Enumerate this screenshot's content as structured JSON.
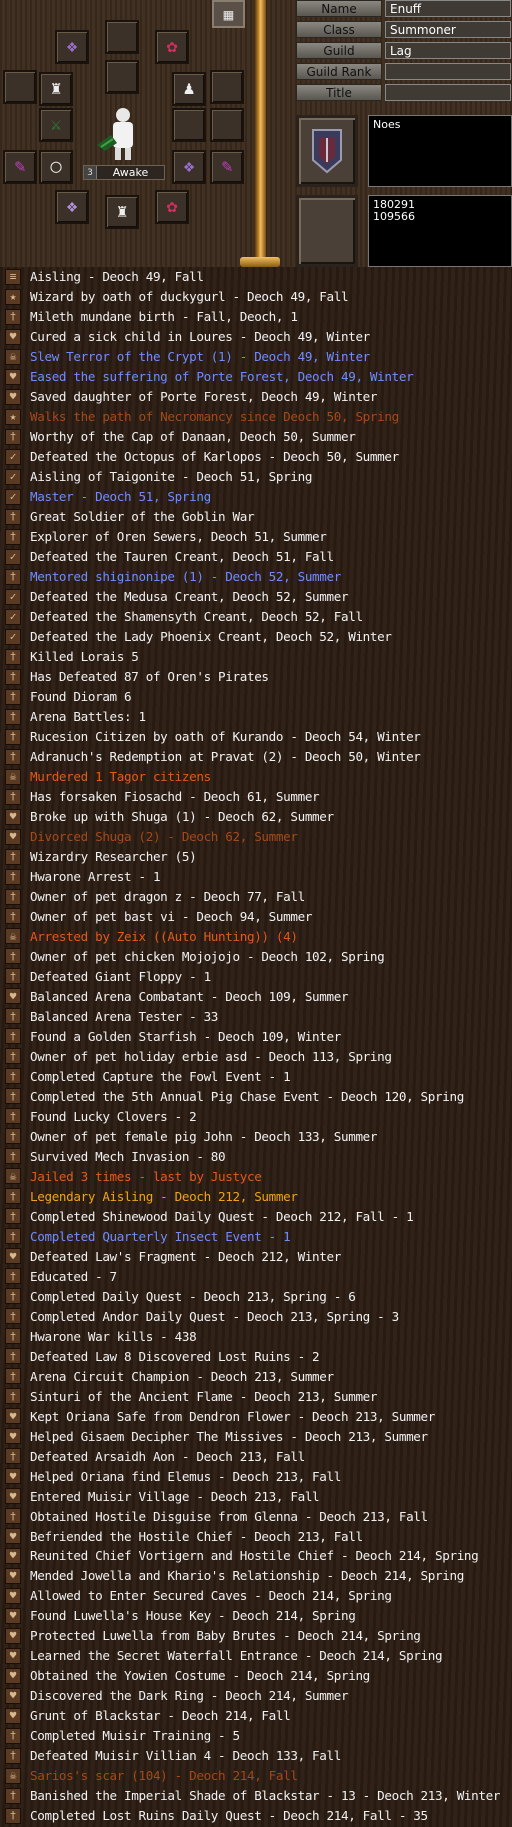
{
  "equipment": {
    "status_number": "3",
    "status_label": "Awake",
    "slot_icons": [
      "necklace-icon",
      "amulet-icon",
      "ring-icon",
      "boot-icon",
      "gauntlet-icon",
      "belt-icon",
      "earring-icon",
      "sword-icon",
      "shield-icon",
      "armor-icon",
      "helm-icon"
    ]
  },
  "profile": {
    "name_label": "Name",
    "name_value": "Enuff",
    "class_label": "Class",
    "class_value": "Summoner",
    "guild_label": "Guild",
    "guild_value": "Lag",
    "guild_rank_label": "Guild Rank",
    "guild_rank_value": "",
    "title_label": "Title",
    "title_value": "",
    "description": "Noes",
    "stats": "180291\n109566"
  },
  "colors": {
    "white": "#f2f2f2",
    "blue": "#6f8dff",
    "orange": "#e25a1a",
    "dark_orange": "#a34a1a",
    "yellow": "#f0a21a"
  },
  "legends": [
    {
      "icon": "scroll-icon",
      "color": "white",
      "text": "Aisling - Deoch 49, Fall"
    },
    {
      "icon": "wizard-icon",
      "color": "white",
      "text": "Wizard by oath of duckygurl - Deoch 49, Fall"
    },
    {
      "icon": "person-icon",
      "color": "white",
      "text": "Mileth mundane birth - Fall, Deoch, 1"
    },
    {
      "icon": "heart-icon",
      "color": "white",
      "text": "Cured a sick child in Loures - Deoch 49, Winter"
    },
    {
      "icon": "skull-icon",
      "color": "blue",
      "text": "Slew Terror of the Crypt (1) - Deoch 49, Winter"
    },
    {
      "icon": "heart-icon",
      "color": "blue",
      "text": "Eased the suffering of Porte Forest, Deoch 49, Winter"
    },
    {
      "icon": "heart-icon",
      "color": "white",
      "text": "Saved daughter of Porte Forest, Deoch 49, Winter"
    },
    {
      "icon": "wizard-icon",
      "color": "dark_orange",
      "text": "Walks the path of Necromancy since Deoch 50, Spring"
    },
    {
      "icon": "person-icon",
      "color": "white",
      "text": "Worthy of the Cap of Danaan, Deoch 50, Summer"
    },
    {
      "icon": "check-icon",
      "color": "white",
      "text": "Defeated the Octopus of Karlopos - Deoch 50, Summer"
    },
    {
      "icon": "check-icon",
      "color": "white",
      "text": "Aisling of Taigonite - Deoch 51, Spring"
    },
    {
      "icon": "check-icon",
      "color": "blue",
      "text": "Master - Deoch 51, Spring"
    },
    {
      "icon": "person-icon",
      "color": "white",
      "text": "Great Soldier of the Goblin War"
    },
    {
      "icon": "person-icon",
      "color": "white",
      "text": "Explorer of Oren Sewers, Deoch 51, Summer"
    },
    {
      "icon": "check-icon",
      "color": "white",
      "text": "Defeated the Tauren Creant, Deoch 51, Fall"
    },
    {
      "icon": "person-icon",
      "color": "blue",
      "text": "Mentored shiginonipe (1) - Deoch 52, Summer"
    },
    {
      "icon": "check-icon",
      "color": "white",
      "text": "Defeated the Medusa Creant, Deoch 52, Summer"
    },
    {
      "icon": "check-icon",
      "color": "white",
      "text": "Defeated the Shamensyth Creant, Deoch 52, Fall"
    },
    {
      "icon": "check-icon",
      "color": "white",
      "text": "Defeated the Lady Phoenix Creant, Deoch 52, Winter"
    },
    {
      "icon": "person-icon",
      "color": "white",
      "text": "Killed Lorais 5"
    },
    {
      "icon": "person-icon",
      "color": "white",
      "text": "Has Defeated 87 of Oren's Pirates"
    },
    {
      "icon": "person-icon",
      "color": "white",
      "text": "Found Dioram 6"
    },
    {
      "icon": "person-icon",
      "color": "white",
      "text": "Arena Battles: 1"
    },
    {
      "icon": "person-icon",
      "color": "white",
      "text": "Rucesion Citizen by oath of Kurando - Deoch 54, Winter"
    },
    {
      "icon": "person-icon",
      "color": "white",
      "text": "Adranuch's Redemption at Pravat (2) - Deoch 50, Winter"
    },
    {
      "icon": "skull-icon",
      "color": "orange",
      "text": "Murdered 1 Tagor citizens"
    },
    {
      "icon": "person-icon",
      "color": "white",
      "text": "Has forsaken Fiosachd - Deoch 61, Summer"
    },
    {
      "icon": "heart-icon",
      "color": "white",
      "text": "Broke up with Shuga (1) - Deoch 62, Summer"
    },
    {
      "icon": "heart-icon",
      "color": "dark_orange",
      "text": "Divorced Shuga (2) - Deoch 62, Summer"
    },
    {
      "icon": "person-icon",
      "color": "white",
      "text": "Wizardry Researcher (5)"
    },
    {
      "icon": "person-icon",
      "color": "white",
      "text": "Hwarone Arrest - 1"
    },
    {
      "icon": "person-icon",
      "color": "white",
      "text": "Owner of pet dragon z - Deoch 77, Fall"
    },
    {
      "icon": "person-icon",
      "color": "white",
      "text": "Owner of pet bast vi - Deoch 94, Summer"
    },
    {
      "icon": "skull-icon",
      "color": "orange",
      "text": "Arrested by Zeix ((Auto Hunting)) (4)"
    },
    {
      "icon": "person-icon",
      "color": "white",
      "text": "Owner of pet chicken Mojojojo - Deoch 102, Spring"
    },
    {
      "icon": "person-icon",
      "color": "white",
      "text": "Defeated Giant Floppy - 1"
    },
    {
      "icon": "heart-icon",
      "color": "white",
      "text": "Balanced Arena Combatant - Deoch 109, Summer"
    },
    {
      "icon": "person-icon",
      "color": "white",
      "text": "Balanced Arena Tester - 33"
    },
    {
      "icon": "person-icon",
      "color": "white",
      "text": "Found a Golden Starfish - Deoch 109, Winter"
    },
    {
      "icon": "person-icon",
      "color": "white",
      "text": "Owner of pet holiday erbie asd - Deoch 113, Spring"
    },
    {
      "icon": "person-icon",
      "color": "white",
      "text": "Completed Capture the Fowl Event - 1"
    },
    {
      "icon": "person-icon",
      "color": "white",
      "text": "Completed the 5th Annual Pig Chase Event - Deoch 120, Spring"
    },
    {
      "icon": "person-icon",
      "color": "white",
      "text": "Found Lucky Clovers - 2"
    },
    {
      "icon": "person-icon",
      "color": "white",
      "text": "Owner of pet female pig John - Deoch 133, Summer"
    },
    {
      "icon": "person-icon",
      "color": "white",
      "text": "Survived Mech Invasion - 80"
    },
    {
      "icon": "skull-icon",
      "color": "orange",
      "text": "Jailed 3 times - last by Justyce"
    },
    {
      "icon": "person-icon",
      "color": "yellow",
      "text": "Legendary Aisling - Deoch 212, Summer"
    },
    {
      "icon": "person-icon",
      "color": "white",
      "text": "Completed Shinewood Daily Quest - Deoch 212, Fall - 1"
    },
    {
      "icon": "person-icon",
      "color": "blue",
      "text": "Completed Quarterly Insect Event - 1"
    },
    {
      "icon": "heart-icon",
      "color": "white",
      "text": "Defeated Law's Fragment - Deoch 212, Winter"
    },
    {
      "icon": "person-icon",
      "color": "white",
      "text": "Educated - 7"
    },
    {
      "icon": "person-icon",
      "color": "white",
      "text": "Completed Daily Quest - Deoch 213, Spring - 6"
    },
    {
      "icon": "person-icon",
      "color": "white",
      "text": "Completed Andor Daily Quest - Deoch 213, Spring - 3"
    },
    {
      "icon": "person-icon",
      "color": "white",
      "text": "Hwarone War kills - 438"
    },
    {
      "icon": "person-icon",
      "color": "white",
      "text": "Defeated Law 8 Discovered Lost Ruins - 2"
    },
    {
      "icon": "person-icon",
      "color": "white",
      "text": "Arena Circuit Champion - Deoch 213, Summer"
    },
    {
      "icon": "person-icon",
      "color": "white",
      "text": "Sinturi of the Ancient Flame - Deoch 213, Summer"
    },
    {
      "icon": "heart-icon",
      "color": "white",
      "text": "Kept Oriana Safe from Dendron Flower - Deoch 213, Summer"
    },
    {
      "icon": "heart-icon",
      "color": "white",
      "text": "Helped Gisaem Decipher The Missives - Deoch 213, Summer"
    },
    {
      "icon": "person-icon",
      "color": "white",
      "text": "Defeated Arsaidh Aon - Deoch 213, Fall"
    },
    {
      "icon": "heart-icon",
      "color": "white",
      "text": "Helped Oriana find Elemus - Deoch 213, Fall"
    },
    {
      "icon": "heart-icon",
      "color": "white",
      "text": "Entered Muisir Village - Deoch 213, Fall"
    },
    {
      "icon": "person-icon",
      "color": "white",
      "text": "Obtained Hostile Disguise from Glenna - Deoch 213, Fall"
    },
    {
      "icon": "heart-icon",
      "color": "white",
      "text": "Befriended the Hostile Chief - Deoch 213, Fall"
    },
    {
      "icon": "heart-icon",
      "color": "white",
      "text": "Reunited Chief Vortigern and Hostile Chief - Deoch 214, Spring"
    },
    {
      "icon": "heart-icon",
      "color": "white",
      "text": "Mended Jowella and Khario's Relationship - Deoch 214, Spring"
    },
    {
      "icon": "heart-icon",
      "color": "white",
      "text": "Allowed to Enter Secured Caves - Deoch 214, Spring"
    },
    {
      "icon": "heart-icon",
      "color": "white",
      "text": "Found Luwella's House Key - Deoch 214, Spring"
    },
    {
      "icon": "heart-icon",
      "color": "white",
      "text": "Protected Luwella from Baby Brutes - Deoch 214, Spring"
    },
    {
      "icon": "heart-icon",
      "color": "white",
      "text": "Learned the Secret Waterfall Entrance - Deoch 214, Spring"
    },
    {
      "icon": "heart-icon",
      "color": "white",
      "text": "Obtained the Yowien Costume - Deoch 214, Spring"
    },
    {
      "icon": "heart-icon",
      "color": "white",
      "text": "Discovered the Dark Ring - Deoch 214, Summer"
    },
    {
      "icon": "heart-icon",
      "color": "white",
      "text": "Grunt of Blackstar - Deoch 214, Fall"
    },
    {
      "icon": "person-icon",
      "color": "white",
      "text": "Completed Muisir Training - 5"
    },
    {
      "icon": "person-icon",
      "color": "white",
      "text": "Defeated Muisir Villian 4 - Deoch 133, Fall"
    },
    {
      "icon": "skull-icon",
      "color": "dark_orange",
      "text": "Sarios's scar (104) - Deoch 214, Fall"
    },
    {
      "icon": "person-icon",
      "color": "white",
      "text": "Banished the Imperial Shade of Blackstar - 13 - Deoch 213, Winter"
    },
    {
      "icon": "person-icon",
      "color": "white",
      "text": "Completed Lost Ruins Daily Quest - Deoch 214, Fall - 35"
    }
  ]
}
